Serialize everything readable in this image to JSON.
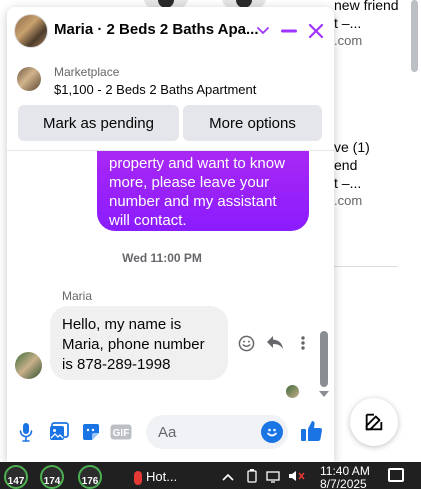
{
  "background": {
    "notifications": [
      {
        "lines": [
          "new friend",
          "t –..."
        ],
        "domain": ".com"
      },
      {
        "lines": [
          "ve (1)",
          "end",
          "t –..."
        ],
        "domain": ".com"
      }
    ]
  },
  "chat": {
    "title": "Maria · 2 Beds 2 Baths Apa...",
    "marketplace": {
      "label": "Marketplace",
      "item": "$1,100 - 2 Beds 2 Baths Apartment",
      "pending_button": "Mark as pending",
      "options_button": "More options"
    },
    "messages": {
      "outgoing_text": "property and want to know more, please leave your number and my assistant will contact.",
      "timestamp": "Wed 11:00 PM",
      "sender": "Maria",
      "incoming_text": "Hello, my name is Maria, phone number is 878-289-1998"
    },
    "composer": {
      "placeholder": "Aa"
    },
    "colors": {
      "accent": "#a033ff",
      "outgoing_start": "#b32bf0",
      "outgoing_end": "#8a1cff",
      "composer_blue": "#1b74e4"
    }
  },
  "taskbar": {
    "badges": [
      "147",
      "174",
      "176"
    ],
    "weather": "Hot...",
    "time": "11:40 AM",
    "date": "8/7/2025"
  }
}
